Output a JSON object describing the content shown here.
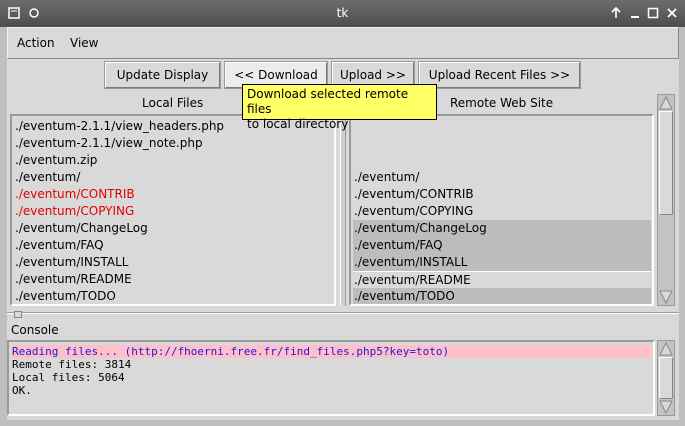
{
  "window": {
    "title": "tk"
  },
  "menubar": {
    "items": [
      "Action",
      "View"
    ]
  },
  "toolbar": {
    "update_display": "Update Display",
    "download": "<< Download",
    "upload": "Upload >>",
    "upload_recent": "Upload Recent Files >>"
  },
  "tooltip": {
    "line1": "Download selected remote files",
    "line2": "to local directory"
  },
  "local": {
    "header": "Local Files",
    "files": [
      {
        "name": "./eventum-2.1.1/view_headers.php",
        "color": "#000000"
      },
      {
        "name": "./eventum-2.1.1/view_note.php",
        "color": "#000000"
      },
      {
        "name": "./eventum.zip",
        "color": "#000000"
      },
      {
        "name": "./eventum/",
        "color": "#000000"
      },
      {
        "name": "./eventum/CONTRIB",
        "color": "#e00000"
      },
      {
        "name": "./eventum/COPYING",
        "color": "#e00000"
      },
      {
        "name": "./eventum/ChangeLog",
        "color": "#000000"
      },
      {
        "name": "./eventum/FAQ",
        "color": "#000000"
      },
      {
        "name": "./eventum/INSTALL",
        "color": "#000000"
      },
      {
        "name": "./eventum/README",
        "color": "#000000"
      },
      {
        "name": "./eventum/TODO",
        "color": "#000000"
      }
    ]
  },
  "remote": {
    "header": "Remote Web Site",
    "files": [
      {
        "name": "",
        "selected": false
      },
      {
        "name": "",
        "selected": false
      },
      {
        "name": "",
        "selected": false
      },
      {
        "name": "./eventum/",
        "selected": false
      },
      {
        "name": "./eventum/CONTRIB",
        "selected": false
      },
      {
        "name": "./eventum/COPYING",
        "selected": false
      },
      {
        "name": "./eventum/ChangeLog",
        "selected": true
      },
      {
        "name": "./eventum/FAQ",
        "selected": true
      },
      {
        "name": "./eventum/INSTALL",
        "selected": true
      },
      {
        "name": "./eventum/README",
        "selected": false
      },
      {
        "name": "./eventum/TODO",
        "selected": true
      }
    ]
  },
  "console": {
    "label": "Console",
    "lines": [
      {
        "text": "Reading files... (http://fhoerni.free.fr/find_files.php5?key=toto)",
        "highlight": true
      },
      {
        "text": "Remote files: 3814",
        "highlight": false
      },
      {
        "text": "Local files: 5064",
        "highlight": false
      },
      {
        "text": "OK.",
        "highlight": false
      }
    ]
  },
  "colors": {
    "titlebar": "#5a5a5a",
    "tooltip_bg": "#ffff66",
    "modified_file": "#e00000",
    "console_highlight": "#ffc0cb",
    "console_link": "#1a1adb"
  }
}
